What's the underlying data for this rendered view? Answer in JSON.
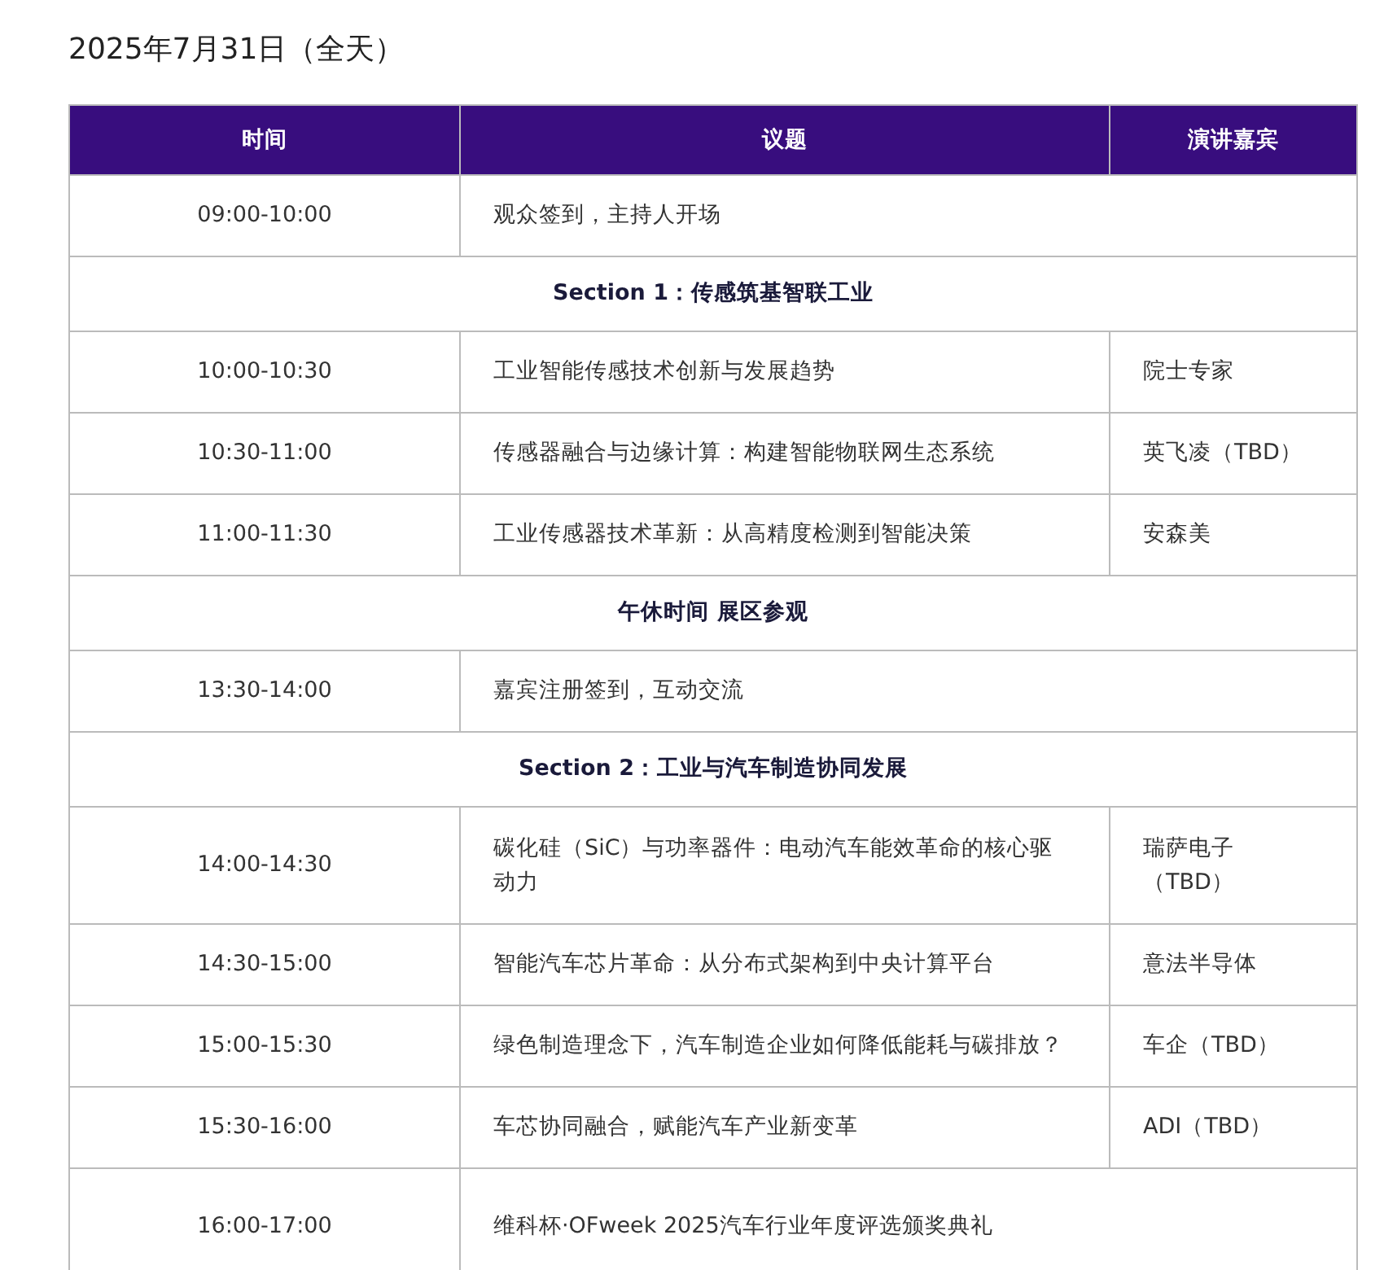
{
  "title": "2025年7月31日（全天）",
  "table": {
    "columns": [
      "时间",
      "议题",
      "演讲嘉宾"
    ],
    "rows": [
      {
        "kind": "session",
        "time": "09:00-10:00",
        "topic": "观众签到，主持人开场"
      },
      {
        "kind": "section",
        "label": "Section 1：传感筑基智联工业"
      },
      {
        "kind": "session",
        "time": "10:00-10:30",
        "topic": "工业智能传感技术创新与发展趋势",
        "speaker": "院士专家"
      },
      {
        "kind": "session",
        "time": "10:30-11:00",
        "topic": "传感器融合与边缘计算：构建智能物联网生态系统",
        "speaker": "英飞凌（TBD）"
      },
      {
        "kind": "session",
        "time": "11:00-11:30",
        "topic": "工业传感器技术革新：从高精度检测到智能决策",
        "speaker": "安森美"
      },
      {
        "kind": "section",
        "label": "午休时间 展区参观"
      },
      {
        "kind": "session",
        "time": "13:30-14:00",
        "topic": "嘉宾注册签到，互动交流"
      },
      {
        "kind": "section",
        "label": "Section 2：工业与汽车制造协同发展"
      },
      {
        "kind": "session",
        "time": "14:00-14:30",
        "topic": "碳化硅（SiC）与功率器件：电动汽车能效革命的核心驱动力",
        "speaker": "瑞萨电子（TBD）"
      },
      {
        "kind": "session",
        "time": "14:30-15:00",
        "topic": "智能汽车芯片革命：从分布式架构到中央计算平台",
        "speaker": "意法半导体"
      },
      {
        "kind": "session",
        "time": "15:00-15:30",
        "topic": "绿色制造理念下，汽车制造企业如何降低能耗与碳排放？",
        "speaker": "车企（TBD）"
      },
      {
        "kind": "session",
        "time": "15:30-16:00",
        "topic": "车芯协同融合，赋能汽车产业新变革",
        "speaker": "ADI（TBD）"
      },
      {
        "kind": "session",
        "time": "16:00-17:00",
        "topic": "维科杯·OFweek 2025汽车行业年度评选颁奖典礼"
      }
    ]
  }
}
